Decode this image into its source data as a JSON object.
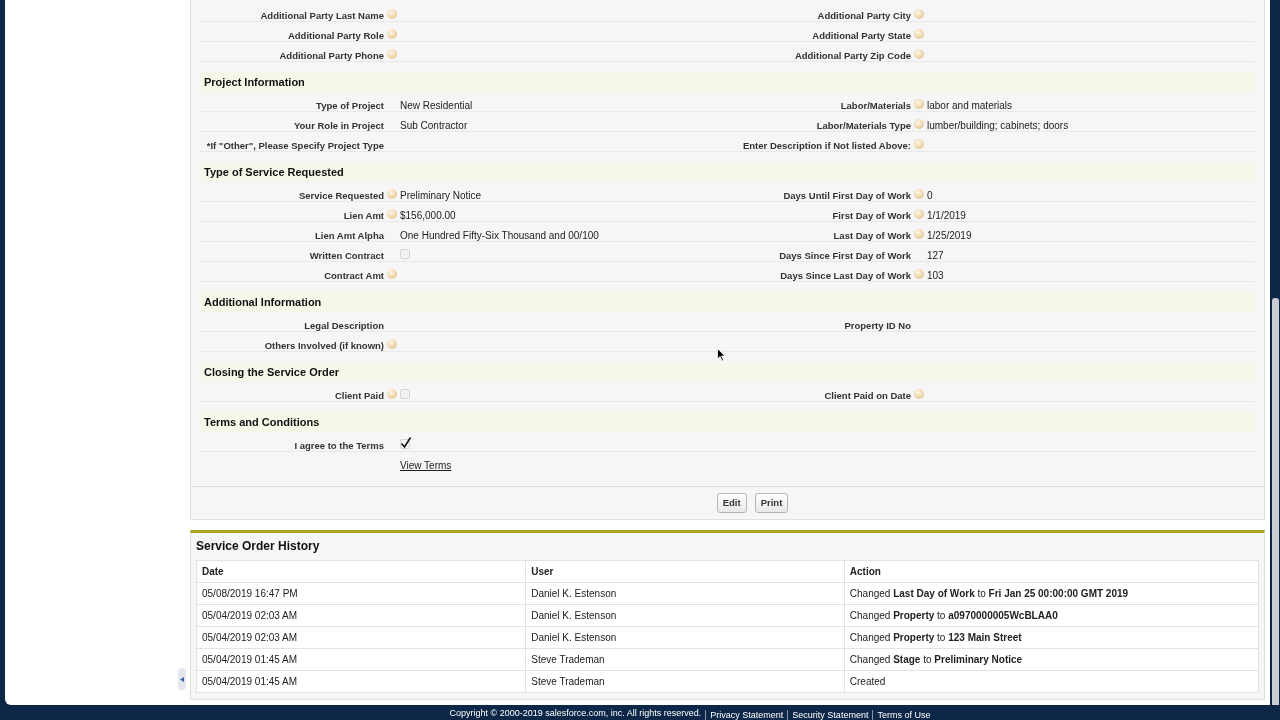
{
  "detail": {
    "sections": [
      {
        "rows": [
          {
            "left": {
              "kind": "text",
              "label": "Additional Party Last Name",
              "help": true
            },
            "right": {
              "kind": "text",
              "label": "Additional Party City",
              "help": true
            }
          },
          {
            "left": {
              "kind": "text",
              "label": "Additional Party Role",
              "help": true
            },
            "right": {
              "kind": "text",
              "label": "Additional Party State",
              "help": true
            }
          },
          {
            "left": {
              "kind": "text",
              "label": "Additional Party Phone",
              "help": true
            },
            "right": {
              "kind": "text",
              "label": "Additional Party Zip Code",
              "help": true
            }
          }
        ]
      },
      {
        "title": "Project Information",
        "rows": [
          {
            "left": {
              "kind": "text",
              "label": "Type of Project",
              "help": false,
              "value": "New Residential"
            },
            "right": {
              "kind": "text",
              "label": "Labor/Materials",
              "help": true,
              "value": "labor and materials"
            }
          },
          {
            "left": {
              "kind": "text",
              "label": "Your Role in Project",
              "help": false,
              "value": "Sub Contractor"
            },
            "right": {
              "kind": "text",
              "label": "Labor/Materials Type",
              "help": true,
              "value": "lumber/building; cabinets; doors"
            }
          },
          {
            "left": {
              "kind": "text",
              "label": "*If \"Other\", Please Specify Project Type",
              "help": false
            },
            "right": {
              "kind": "text",
              "label": "Enter Description if Not listed Above:",
              "help": true
            }
          }
        ]
      },
      {
        "title": "Type of Service Requested",
        "rows": [
          {
            "left": {
              "kind": "text",
              "label": "Service Requested",
              "help": true,
              "value": "Preliminary Notice"
            },
            "right": {
              "kind": "text",
              "label": "Days Until First Day of Work",
              "help": true,
              "value": "0"
            }
          },
          {
            "left": {
              "kind": "text",
              "label": "Lien Amt",
              "help": true,
              "value": "$156,000.00"
            },
            "right": {
              "kind": "text",
              "label": "First Day of Work",
              "help": true,
              "value": "1/1/2019"
            }
          },
          {
            "left": {
              "kind": "text",
              "label": "Lien Amt Alpha",
              "help": false,
              "value": "One Hundred Fifty-Six Thousand and 00/100"
            },
            "right": {
              "kind": "text",
              "label": "Last Day of Work",
              "help": true,
              "value": "1/25/2019"
            }
          },
          {
            "left": {
              "kind": "checkbox",
              "label": "Written Contract",
              "help": false,
              "checked": false
            },
            "right": {
              "kind": "text",
              "label": "Days Since First Day of Work",
              "help": false,
              "value": "127"
            }
          },
          {
            "left": {
              "kind": "text",
              "label": "Contract Amt",
              "help": true
            },
            "right": {
              "kind": "text",
              "label": "Days Since Last Day of Work",
              "help": true,
              "value": "103"
            }
          }
        ]
      },
      {
        "title": "Additional Information",
        "rows": [
          {
            "left": {
              "kind": "text",
              "label": "Legal Description",
              "help": false
            },
            "right": {
              "kind": "text",
              "label": "Property ID No",
              "help": false
            }
          },
          {
            "left": {
              "kind": "text",
              "label": "Others Involved (if known)",
              "help": true
            }
          }
        ]
      },
      {
        "title": "Closing the Service Order",
        "rows": [
          {
            "left": {
              "kind": "checkbox",
              "label": "Client Paid",
              "help": true,
              "checked": false
            },
            "right": {
              "kind": "text",
              "label": "Client Paid on Date",
              "help": true
            }
          }
        ]
      },
      {
        "title": "Terms and Conditions",
        "rows": [
          {
            "left": {
              "kind": "checkbox",
              "label": "I agree to the Terms",
              "help": false,
              "checked": true
            }
          },
          {
            "left": {
              "kind": "link",
              "text": "View Terms"
            }
          }
        ]
      }
    ],
    "buttons": [
      "Edit",
      "Print"
    ]
  },
  "history": {
    "title": "Service Order History",
    "columns": [
      "Date",
      "User",
      "Action"
    ],
    "rows": [
      [
        "05/08/2019 16:47 PM",
        "Daniel K. Estenson",
        "Changed **Last Day of Work** to **Fri Jan 25 00:00:00 GMT 2019**"
      ],
      [
        "05/04/2019 02:03 AM",
        "Daniel K. Estenson",
        "Changed **Property** to **a0970000005WcBLAA0**"
      ],
      [
        "05/04/2019 02:03 AM",
        "Daniel K. Estenson",
        "Changed **Property** to **123 Main Street**"
      ],
      [
        "05/04/2019 01:45 AM",
        "Steve Trademan",
        "Changed **Stage** to **Preliminary Notice**"
      ],
      [
        "05/04/2019 01:45 AM",
        "Steve Trademan",
        "Created"
      ]
    ]
  },
  "footer": {
    "copyright": "Copyright © 2000-2019 salesforce.com, inc. All rights reserved.",
    "links": [
      "Privacy Statement",
      "Security Statement",
      "Terms of Use"
    ]
  }
}
